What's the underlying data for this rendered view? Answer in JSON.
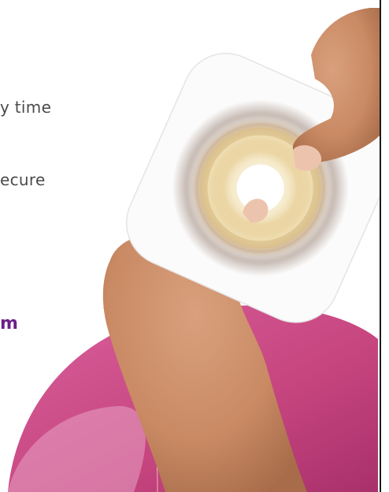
{
  "lines": {
    "line1": "y time",
    "line2": "ecure",
    "line3": "m"
  },
  "colors": {
    "accent_magenta": "#c8488a",
    "accent_purple": "#6a1f8a",
    "text_gray": "#4a4a4a"
  },
  "image": {
    "subject": "hands-holding-ostomy-skin-barrier"
  }
}
